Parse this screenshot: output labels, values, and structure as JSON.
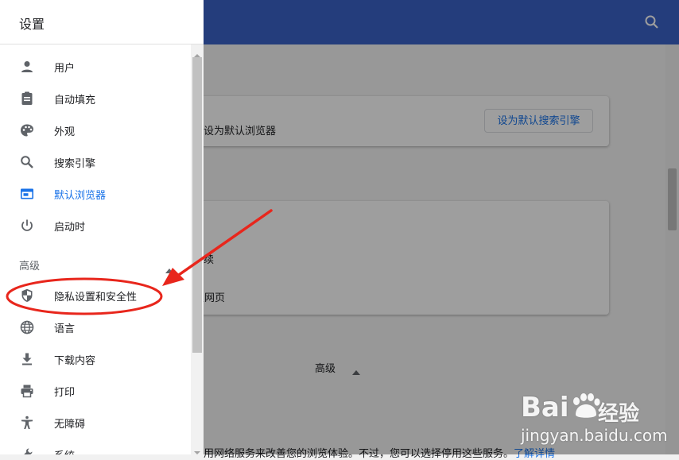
{
  "drawer": {
    "title": "设置",
    "items": [
      {
        "label": "用户",
        "icon": "person-icon"
      },
      {
        "label": "自动填充",
        "icon": "clipboard-icon"
      },
      {
        "label": "外观",
        "icon": "palette-icon"
      },
      {
        "label": "搜索引擎",
        "icon": "search-icon"
      },
      {
        "label": "默认浏览器",
        "icon": "browser-icon",
        "selected": true
      },
      {
        "label": "启动时",
        "icon": "power-icon"
      }
    ],
    "advanced_label": "高级",
    "advanced_items": [
      {
        "label": "隐私设置和安全性",
        "icon": "shield-icon"
      },
      {
        "label": "语言",
        "icon": "globe-icon"
      },
      {
        "label": "下载内容",
        "icon": "download-icon"
      },
      {
        "label": "打印",
        "icon": "printer-icon"
      },
      {
        "label": "无障碍",
        "icon": "accessibility-icon"
      },
      {
        "label": "系统",
        "icon": "wrench-icon"
      }
    ]
  },
  "main": {
    "default_browser_text": "设为默认浏览器",
    "default_search_button": "设为默认搜索引擎",
    "startup_option_1": "续",
    "startup_option_2": "定网页",
    "advanced_label": "高级",
    "footer_text": "用网络服务来改善您的浏览体验。不过，您可以选择停用这些服务。",
    "footer_link": "了解详情"
  },
  "watermark": {
    "brand": "Bai",
    "brand_cn": "经验",
    "url": "jingyan.baidu.com"
  },
  "colors": {
    "header_blue": "#3b63c8",
    "accent_blue": "#1a73e8",
    "annotation_red": "#e8261c"
  }
}
